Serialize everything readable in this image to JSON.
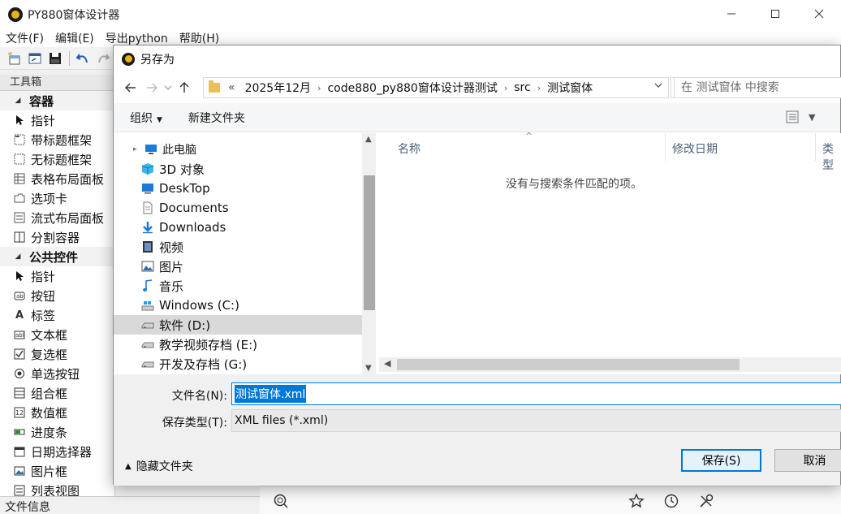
{
  "app": {
    "title": "PY880窗体设计器",
    "menu": [
      "文件(F)",
      "编辑(E)",
      "导出python",
      "帮助(H)"
    ],
    "toolbox_header": "工具箱",
    "toolbox_items": [
      {
        "label": "容器",
        "group": true,
        "icon": "collapse-triangle"
      },
      {
        "label": "指针",
        "group": false,
        "icon": "pointer-arrow"
      },
      {
        "label": "带标题框架",
        "group": false,
        "icon": "titled-frame"
      },
      {
        "label": "无标题框架",
        "group": false,
        "icon": "frame"
      },
      {
        "label": "表格布局面板",
        "group": false,
        "icon": "grid-layout"
      },
      {
        "label": "选项卡",
        "group": false,
        "icon": "tab"
      },
      {
        "label": "流式布局面板",
        "group": false,
        "icon": "flow-layout"
      },
      {
        "label": "分割容器",
        "group": false,
        "icon": "split-container"
      },
      {
        "label": "公共控件",
        "group": true,
        "icon": "collapse-triangle"
      },
      {
        "label": "指针",
        "group": false,
        "icon": "pointer-arrow"
      },
      {
        "label": "按钮",
        "group": false,
        "icon": "button"
      },
      {
        "label": "标签",
        "group": false,
        "icon": "label-a"
      },
      {
        "label": "文本框",
        "group": false,
        "icon": "textbox"
      },
      {
        "label": "复选框",
        "group": false,
        "icon": "checkbox"
      },
      {
        "label": "单选按钮",
        "group": false,
        "icon": "radio"
      },
      {
        "label": "组合框",
        "group": false,
        "icon": "combobox"
      },
      {
        "label": "数值框",
        "group": false,
        "icon": "numeric"
      },
      {
        "label": "进度条",
        "group": false,
        "icon": "progress"
      },
      {
        "label": "日期选择器",
        "group": false,
        "icon": "calendar"
      },
      {
        "label": "图片框",
        "group": false,
        "icon": "picture"
      },
      {
        "label": "列表视图",
        "group": false,
        "icon": "listview"
      }
    ],
    "status": "文件信息"
  },
  "dialog": {
    "title": "另存为",
    "breadcrumb": [
      "«",
      "2025年12月",
      "code880_py880窗体设计器测试",
      "src",
      "测试窗体"
    ],
    "search_placeholder": "在 测试窗体 中搜索",
    "organize": "组织",
    "new_folder": "新建文件夹",
    "nav": [
      {
        "label": "此电脑",
        "kind": "pc",
        "icon": "computer-icon"
      },
      {
        "label": "3D 对象",
        "kind": "item",
        "icon": "cube-icon"
      },
      {
        "label": "DeskTop",
        "kind": "item",
        "icon": "desktop-icon"
      },
      {
        "label": "Documents",
        "kind": "item",
        "icon": "documents-icon"
      },
      {
        "label": "Downloads",
        "kind": "item",
        "icon": "download-icon"
      },
      {
        "label": "视频",
        "kind": "item",
        "icon": "video-icon"
      },
      {
        "label": "图片",
        "kind": "item",
        "icon": "pictures-icon"
      },
      {
        "label": "音乐",
        "kind": "item",
        "icon": "music-icon"
      },
      {
        "label": "Windows (C:)",
        "kind": "item",
        "icon": "windows-drive-icon"
      },
      {
        "label": "软件 (D:)",
        "kind": "item",
        "icon": "drive-icon",
        "selected": true
      },
      {
        "label": "教学视频存档 (E:)",
        "kind": "item",
        "icon": "drive-icon"
      },
      {
        "label": "开发及存档 (G:)",
        "kind": "item",
        "icon": "drive-icon"
      }
    ],
    "columns": [
      "名称",
      "修改日期",
      "类型"
    ],
    "empty_message": "没有与搜索条件匹配的项。",
    "filename_label": "文件名(N):",
    "filename_value": "测试窗体.xml",
    "filetype_label": "保存类型(T):",
    "filetype_value": "XML files (*.xml)",
    "hide_folders": "隐藏文件夹",
    "save": "保存(S)",
    "cancel": "取消"
  },
  "colors": {
    "accent": "#0078d7",
    "selected_row": "#d9d9d9"
  }
}
